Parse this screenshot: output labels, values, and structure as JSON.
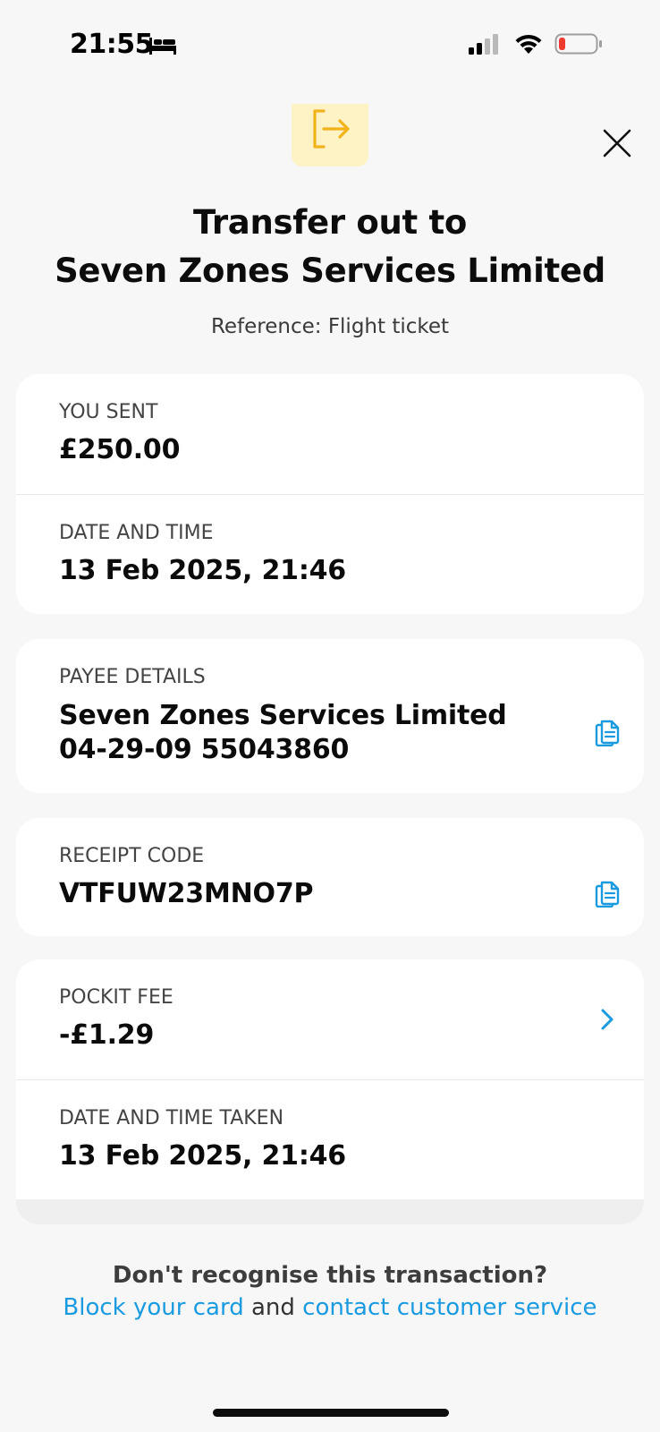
{
  "status_bar": {
    "time": "21:55",
    "icons": [
      "bed-icon",
      "signal-icon",
      "wifi-icon",
      "battery-low-icon"
    ]
  },
  "header": {
    "icon": "transfer-out-icon",
    "close_icon": "close-icon",
    "title_line1": "Transfer out to",
    "title_line2": "Seven Zones Services Limited",
    "reference": "Reference: Flight ticket"
  },
  "card_amount": {
    "you_sent_label": "YOU SENT",
    "you_sent_value": "£250.00",
    "date_label": "DATE AND TIME",
    "date_value": "13 Feb 2025, 21:46"
  },
  "card_payee": {
    "label": "PAYEE DETAILS",
    "name": "Seven Zones Services Limited",
    "account": "04-29-09 55043860"
  },
  "card_receipt": {
    "label": "RECEIPT CODE",
    "value": "VTFUW23MNO7P"
  },
  "card_fee": {
    "fee_label": "POCKIT FEE",
    "fee_value": "-£1.29",
    "taken_label": "DATE AND TIME TAKEN",
    "taken_value": "13 Feb 2025, 21:46"
  },
  "footer": {
    "question": "Don't recognise this transaction?",
    "block_link": "Block your card",
    "and_text": " and ",
    "contact_link": "contact customer service"
  },
  "colors": {
    "accent_blue": "#1a9be0",
    "icon_yellow": "#f2b21c",
    "icon_bg": "#fdf3c4",
    "background": "#f7f7f7"
  }
}
